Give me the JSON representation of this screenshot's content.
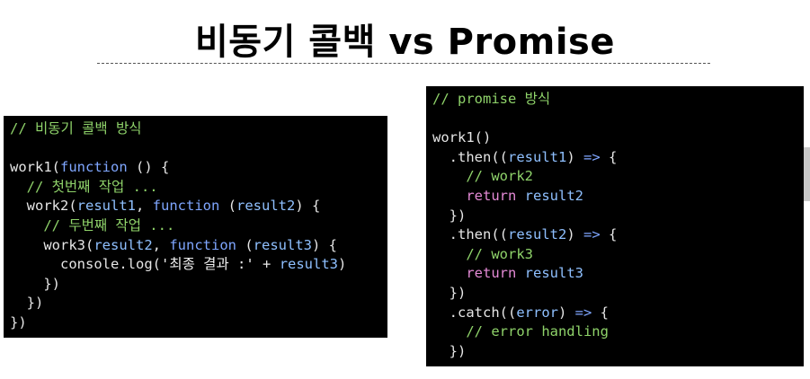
{
  "title": "비동기 콜백  vs  Promise",
  "callback_code": {
    "lines": [
      {
        "indent": "",
        "segments": [
          {
            "t": "cm",
            "v": "// 비동기 콜백 방식"
          }
        ]
      },
      {
        "indent": "",
        "segments": []
      },
      {
        "indent": "",
        "segments": [
          {
            "t": "pl",
            "v": "work1("
          },
          {
            "t": "kw",
            "v": "function"
          },
          {
            "t": "pl",
            "v": " () {"
          }
        ]
      },
      {
        "indent": "  ",
        "segments": [
          {
            "t": "cm",
            "v": "// 첫번째 작업 ..."
          }
        ]
      },
      {
        "indent": "  ",
        "segments": [
          {
            "t": "pl",
            "v": "work2("
          },
          {
            "t": "par",
            "v": "result1"
          },
          {
            "t": "pl",
            "v": ", "
          },
          {
            "t": "kw",
            "v": "function"
          },
          {
            "t": "pl",
            "v": " ("
          },
          {
            "t": "par",
            "v": "result2"
          },
          {
            "t": "pl",
            "v": ") {"
          }
        ]
      },
      {
        "indent": "    ",
        "segments": [
          {
            "t": "cm",
            "v": "// 두번째 작업 ..."
          }
        ]
      },
      {
        "indent": "    ",
        "segments": [
          {
            "t": "pl",
            "v": "work3("
          },
          {
            "t": "par",
            "v": "result2"
          },
          {
            "t": "pl",
            "v": ", "
          },
          {
            "t": "kw",
            "v": "function"
          },
          {
            "t": "pl",
            "v": " ("
          },
          {
            "t": "par",
            "v": "result3"
          },
          {
            "t": "pl",
            "v": ") {"
          }
        ]
      },
      {
        "indent": "      ",
        "segments": [
          {
            "t": "pl",
            "v": "console.log("
          },
          {
            "t": "str",
            "v": "'최종 결과 :'"
          },
          {
            "t": "pl",
            "v": " + "
          },
          {
            "t": "par",
            "v": "result3"
          },
          {
            "t": "pl",
            "v": ")"
          }
        ]
      },
      {
        "indent": "    ",
        "segments": [
          {
            "t": "pl",
            "v": "})"
          }
        ]
      },
      {
        "indent": "  ",
        "segments": [
          {
            "t": "pl",
            "v": "})"
          }
        ]
      },
      {
        "indent": "",
        "segments": [
          {
            "t": "pl",
            "v": "})"
          }
        ]
      }
    ]
  },
  "promise_code": {
    "lines": [
      {
        "indent": "",
        "segments": [
          {
            "t": "cm",
            "v": "// promise 방식"
          }
        ]
      },
      {
        "indent": "",
        "segments": []
      },
      {
        "indent": "",
        "segments": [
          {
            "t": "pl",
            "v": "work1()"
          }
        ]
      },
      {
        "indent": "  ",
        "segments": [
          {
            "t": "pl",
            "v": ".then(("
          },
          {
            "t": "par",
            "v": "result1"
          },
          {
            "t": "pl",
            "v": ") "
          },
          {
            "t": "kw",
            "v": "=>"
          },
          {
            "t": "pl",
            "v": " {"
          }
        ]
      },
      {
        "indent": "    ",
        "segments": [
          {
            "t": "cm",
            "v": "// work2"
          }
        ]
      },
      {
        "indent": "    ",
        "segments": [
          {
            "t": "rt",
            "v": "return"
          },
          {
            "t": "pl",
            "v": " "
          },
          {
            "t": "par",
            "v": "result2"
          }
        ]
      },
      {
        "indent": "  ",
        "segments": [
          {
            "t": "pl",
            "v": "})"
          }
        ]
      },
      {
        "indent": "  ",
        "segments": [
          {
            "t": "pl",
            "v": ".then(("
          },
          {
            "t": "par",
            "v": "result2"
          },
          {
            "t": "pl",
            "v": ") "
          },
          {
            "t": "kw",
            "v": "=>"
          },
          {
            "t": "pl",
            "v": " {"
          }
        ]
      },
      {
        "indent": "    ",
        "segments": [
          {
            "t": "cm",
            "v": "// work3"
          }
        ]
      },
      {
        "indent": "    ",
        "segments": [
          {
            "t": "rt",
            "v": "return"
          },
          {
            "t": "pl",
            "v": " "
          },
          {
            "t": "par",
            "v": "result3"
          }
        ]
      },
      {
        "indent": "  ",
        "segments": [
          {
            "t": "pl",
            "v": "})"
          }
        ]
      },
      {
        "indent": "  ",
        "segments": [
          {
            "t": "pl",
            "v": ".catch(("
          },
          {
            "t": "par",
            "v": "error"
          },
          {
            "t": "pl",
            "v": ") "
          },
          {
            "t": "kw",
            "v": "=>"
          },
          {
            "t": "pl",
            "v": " {"
          }
        ]
      },
      {
        "indent": "    ",
        "segments": [
          {
            "t": "cm",
            "v": "// error handling"
          }
        ]
      },
      {
        "indent": "  ",
        "segments": [
          {
            "t": "pl",
            "v": "})"
          }
        ]
      }
    ]
  },
  "colors": {
    "background": "#ffffff",
    "code_background": "#000000",
    "comment": "#8fd36a",
    "keyword": "#7fa6ff",
    "parameter": "#8fc0ff",
    "return_keyword": "#e48ad6",
    "plain": "#e6e6e6"
  }
}
